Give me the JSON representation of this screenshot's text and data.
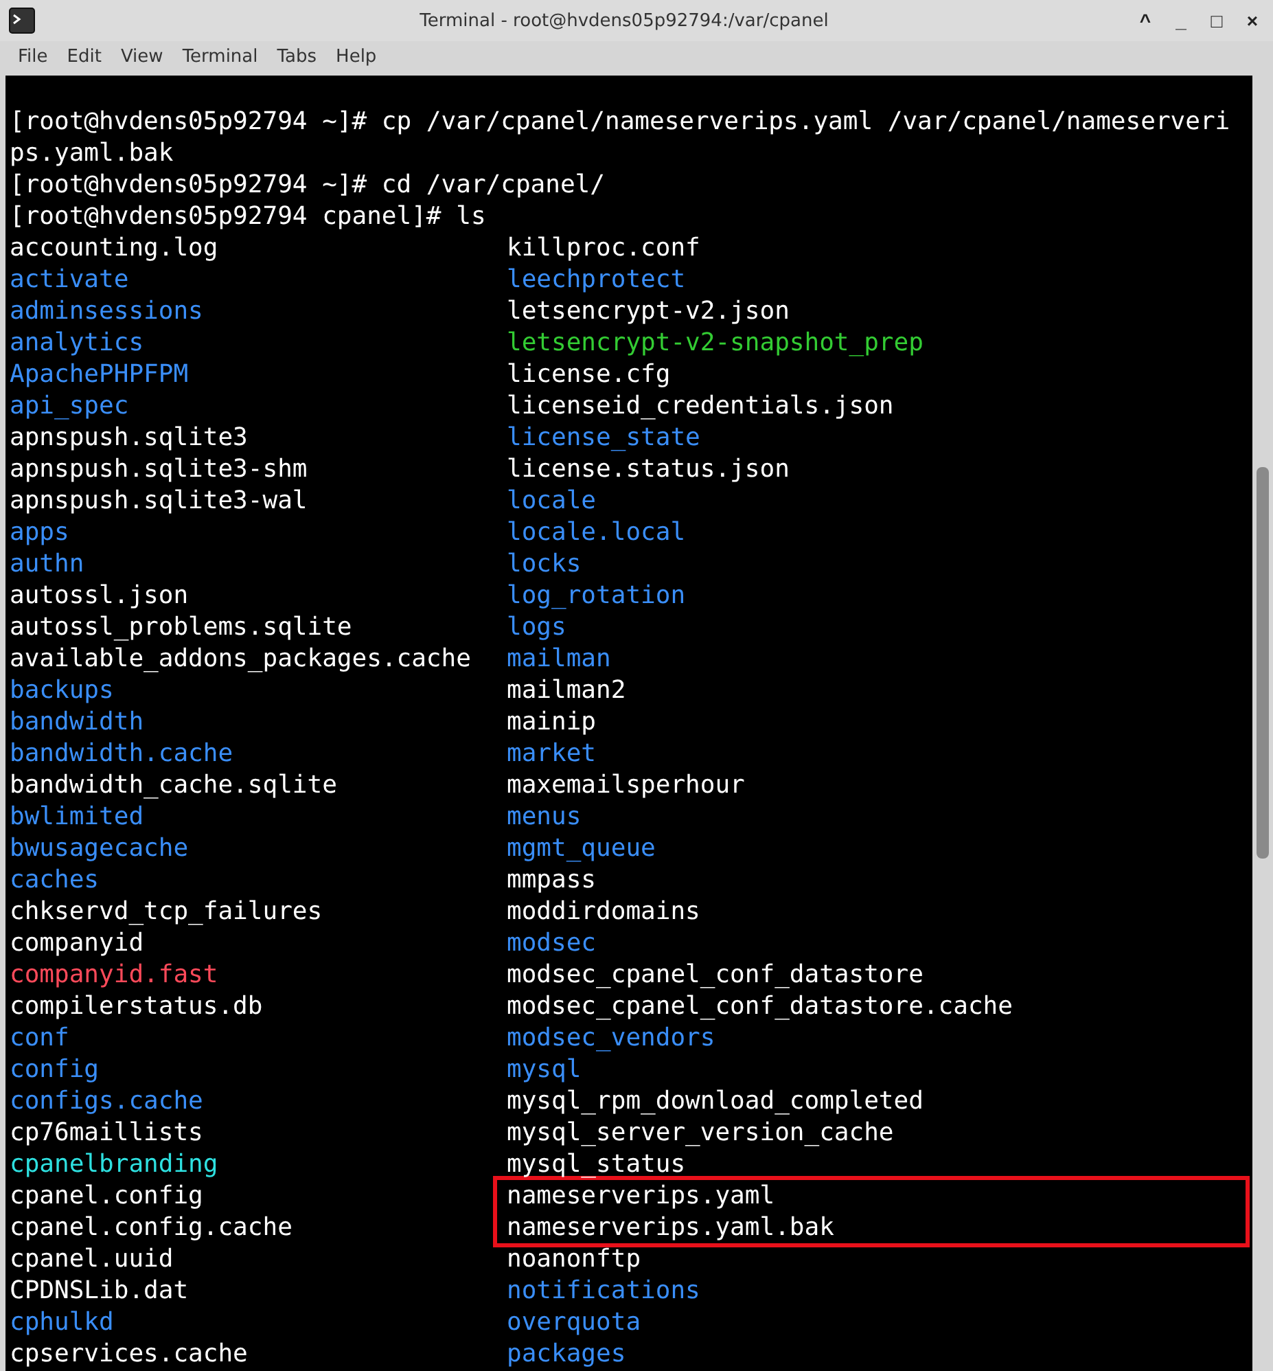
{
  "window": {
    "title": "Terminal - root@hvdens05p92794:/var/cpanel",
    "controls": [
      "^",
      "_",
      "□",
      "×"
    ]
  },
  "menu": [
    "File",
    "Edit",
    "View",
    "Terminal",
    "Tabs",
    "Help"
  ],
  "lines": [
    "[root@hvdens05p92794 ~]# cp /var/cpanel/nameserverips.yaml /var/cpanel/nameserveri",
    "ps.yaml.bak",
    "[root@hvdens05p92794 ~]# cd /var/cpanel/",
    "[root@hvdens05p92794 cpanel]# ls"
  ],
  "columns": [
    [
      {
        "name": "accounting.log",
        "kind": "file"
      },
      {
        "name": "activate",
        "kind": "dir"
      },
      {
        "name": "adminsessions",
        "kind": "dir"
      },
      {
        "name": "analytics",
        "kind": "dir"
      },
      {
        "name": "ApachePHPFPM",
        "kind": "dir"
      },
      {
        "name": "api_spec",
        "kind": "dir"
      },
      {
        "name": "apnspush.sqlite3",
        "kind": "file"
      },
      {
        "name": "apnspush.sqlite3-shm",
        "kind": "file"
      },
      {
        "name": "apnspush.sqlite3-wal",
        "kind": "file"
      },
      {
        "name": "apps",
        "kind": "dir"
      },
      {
        "name": "authn",
        "kind": "dir"
      },
      {
        "name": "autossl.json",
        "kind": "file"
      },
      {
        "name": "autossl_problems.sqlite",
        "kind": "file"
      },
      {
        "name": "available_addons_packages.cache",
        "kind": "file"
      },
      {
        "name": "backups",
        "kind": "dir"
      },
      {
        "name": "bandwidth",
        "kind": "dir"
      },
      {
        "name": "bandwidth.cache",
        "kind": "dir"
      },
      {
        "name": "bandwidth_cache.sqlite",
        "kind": "file"
      },
      {
        "name": "bwlimited",
        "kind": "dir"
      },
      {
        "name": "bwusagecache",
        "kind": "dir"
      },
      {
        "name": "caches",
        "kind": "dir"
      },
      {
        "name": "chkservd_tcp_failures",
        "kind": "file"
      },
      {
        "name": "companyid",
        "kind": "file"
      },
      {
        "name": "companyid.fast",
        "kind": "broken"
      },
      {
        "name": "compilerstatus.db",
        "kind": "file"
      },
      {
        "name": "conf",
        "kind": "dir"
      },
      {
        "name": "config",
        "kind": "dir"
      },
      {
        "name": "configs.cache",
        "kind": "dir"
      },
      {
        "name": "cp76maillists",
        "kind": "file"
      },
      {
        "name": "cpanelbranding",
        "kind": "link"
      },
      {
        "name": "cpanel.config",
        "kind": "file"
      },
      {
        "name": "cpanel.config.cache",
        "kind": "file"
      },
      {
        "name": "cpanel.uuid",
        "kind": "file"
      },
      {
        "name": "CPDNSLib.dat",
        "kind": "file"
      },
      {
        "name": "cphulkd",
        "kind": "dir"
      },
      {
        "name": "cpservices.cache",
        "kind": "file"
      }
    ],
    [
      {
        "name": "killproc.conf",
        "kind": "file"
      },
      {
        "name": "leechprotect",
        "kind": "dir"
      },
      {
        "name": "letsencrypt-v2.json",
        "kind": "file"
      },
      {
        "name": "letsencrypt-v2-snapshot_prep",
        "kind": "exec"
      },
      {
        "name": "license.cfg",
        "kind": "file"
      },
      {
        "name": "licenseid_credentials.json",
        "kind": "file"
      },
      {
        "name": "license_state",
        "kind": "dir"
      },
      {
        "name": "license.status.json",
        "kind": "file"
      },
      {
        "name": "locale",
        "kind": "dir"
      },
      {
        "name": "locale.local",
        "kind": "dir"
      },
      {
        "name": "locks",
        "kind": "dir"
      },
      {
        "name": "log_rotation",
        "kind": "dir"
      },
      {
        "name": "logs",
        "kind": "dir"
      },
      {
        "name": "mailman",
        "kind": "dir"
      },
      {
        "name": "mailman2",
        "kind": "file"
      },
      {
        "name": "mainip",
        "kind": "file"
      },
      {
        "name": "market",
        "kind": "dir"
      },
      {
        "name": "maxemailsperhour",
        "kind": "file"
      },
      {
        "name": "menus",
        "kind": "dir"
      },
      {
        "name": "mgmt_queue",
        "kind": "dir"
      },
      {
        "name": "mmpass",
        "kind": "file"
      },
      {
        "name": "moddirdomains",
        "kind": "file"
      },
      {
        "name": "modsec",
        "kind": "dir"
      },
      {
        "name": "modsec_cpanel_conf_datastore",
        "kind": "file"
      },
      {
        "name": "modsec_cpanel_conf_datastore.cache",
        "kind": "file"
      },
      {
        "name": "modsec_vendors",
        "kind": "dir"
      },
      {
        "name": "mysql",
        "kind": "dir"
      },
      {
        "name": "mysql_rpm_download_completed",
        "kind": "file"
      },
      {
        "name": "mysql_server_version_cache",
        "kind": "file"
      },
      {
        "name": "mysql_status",
        "kind": "file"
      },
      {
        "name": "nameserverips.yaml",
        "kind": "file",
        "highlighted": true
      },
      {
        "name": "nameserverips.yaml.bak",
        "kind": "file",
        "highlighted": true
      },
      {
        "name": "noanonftp",
        "kind": "file"
      },
      {
        "name": "notifications",
        "kind": "dir"
      },
      {
        "name": "overquota",
        "kind": "dir"
      },
      {
        "name": "packages",
        "kind": "dir"
      }
    ]
  ]
}
